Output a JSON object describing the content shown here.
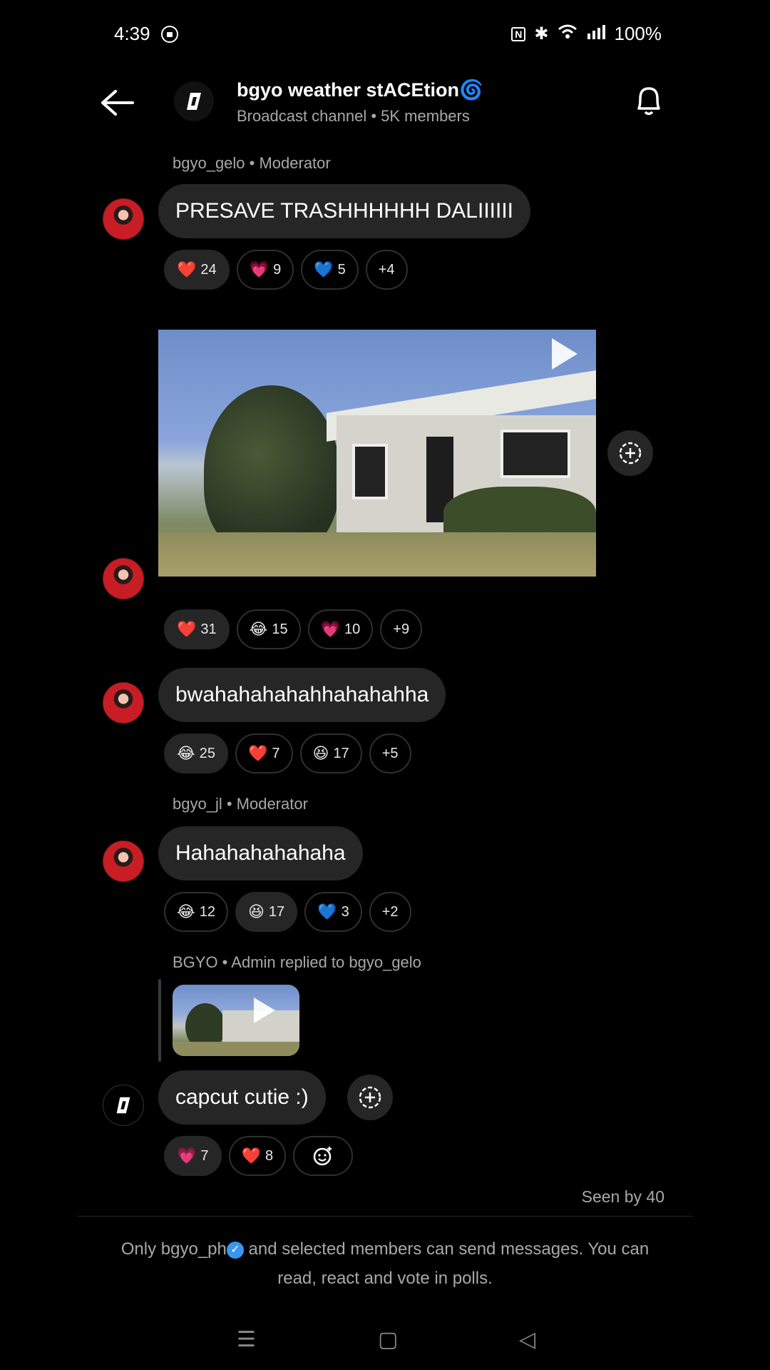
{
  "status_bar": {
    "time": "4:39",
    "battery": "100%",
    "icons": [
      "lock-icon",
      "nfc-icon",
      "bluetooth-icon",
      "wifi-icon",
      "signal-icon"
    ]
  },
  "header": {
    "title": "bgyo weather stACEtion🌀",
    "subtitle": "Broadcast channel • 5K members"
  },
  "messages": [
    {
      "sender": "bgyo_gelo • Moderator",
      "text": "PRESAVE TRASHHHHHH DALIIIIII",
      "reactions": [
        {
          "emoji": "❤️",
          "count": "24",
          "mine": true
        },
        {
          "emoji": "💗",
          "count": "9",
          "mine": false
        },
        {
          "emoji": "💙",
          "count": "5",
          "mine": false
        },
        {
          "emoji": "",
          "count": "+4",
          "mine": false
        }
      ]
    },
    {
      "type": "video",
      "reactions": [
        {
          "emoji": "❤️",
          "count": "31",
          "mine": true
        },
        {
          "emoji": "😂",
          "count": "15",
          "mine": false
        },
        {
          "emoji": "💗",
          "count": "10",
          "mine": false
        },
        {
          "emoji": "",
          "count": "+9",
          "mine": false
        }
      ]
    },
    {
      "text": "bwahahahahahhahahahha",
      "reactions": [
        {
          "emoji": "😂",
          "count": "25",
          "mine": true
        },
        {
          "emoji": "❤️",
          "count": "7",
          "mine": false
        },
        {
          "emoji": "😆",
          "count": "17",
          "mine": false
        },
        {
          "emoji": "",
          "count": "+5",
          "mine": false
        }
      ]
    },
    {
      "sender": "bgyo_jl • Moderator",
      "text": "Hahahahahahaha",
      "reactions": [
        {
          "emoji": "😂",
          "count": "12",
          "mine": false
        },
        {
          "emoji": "😆",
          "count": "17",
          "mine": true
        },
        {
          "emoji": "💙",
          "count": "3",
          "mine": false
        },
        {
          "emoji": "",
          "count": "+2",
          "mine": false
        }
      ]
    },
    {
      "sender": "BGYO • Admin replied to bgyo_gelo",
      "text": "capcut cutie :)",
      "reactions": [
        {
          "emoji": "💗",
          "count": "7",
          "mine": true
        },
        {
          "emoji": "❤️",
          "count": "8",
          "mine": false
        }
      ]
    }
  ],
  "seen": "Seen by 40",
  "footer": {
    "line1_a": "Only bgyo_ph",
    "line1_b": " and selected members can send messages. You can",
    "line2": "read, react and vote in polls."
  },
  "nav": {
    "menu": "☰",
    "home": "▢",
    "back": "◁"
  }
}
